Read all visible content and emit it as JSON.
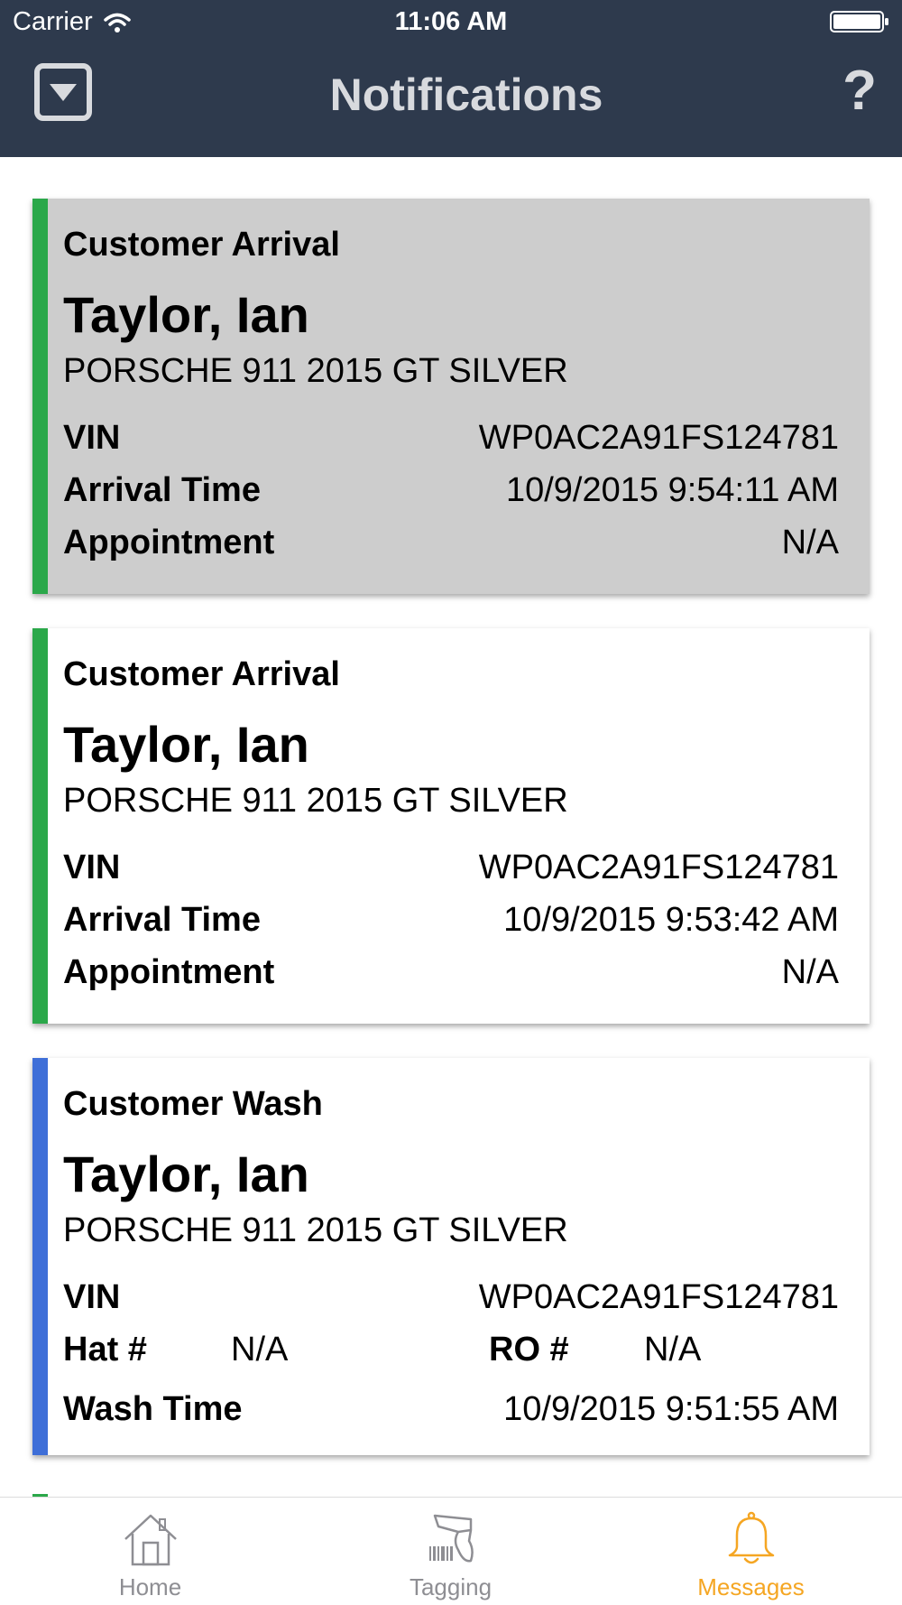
{
  "status_bar": {
    "carrier": "Carrier",
    "time": "11:06 AM"
  },
  "nav": {
    "title": "Notifications",
    "help_label": "?"
  },
  "colors": {
    "navbar": "#2e3a4d",
    "arrival_stripe": "#2ba84a",
    "wash_stripe": "#3f6fd8",
    "read_card": "#cdcdcd",
    "active_tab": "#f5a623"
  },
  "notifications": [
    {
      "type": "Customer Arrival",
      "name": "Taylor, Ian",
      "vehicle": "PORSCHE 911 2015 GT SILVER",
      "vin_label": "VIN",
      "vin": "WP0AC2A91FS124781",
      "time_label": "Arrival Time",
      "time": "10/9/2015 9:54:11 AM",
      "appointment_label": "Appointment",
      "appointment": "N/A"
    },
    {
      "type": "Customer Arrival",
      "name": "Taylor, Ian",
      "vehicle": "PORSCHE 911 2015 GT SILVER",
      "vin_label": "VIN",
      "vin": "WP0AC2A91FS124781",
      "time_label": "Arrival Time",
      "time": "10/9/2015 9:53:42 AM",
      "appointment_label": "Appointment",
      "appointment": "N/A"
    },
    {
      "type": "Customer Wash",
      "name": "Taylor, Ian",
      "vehicle": "PORSCHE 911 2015 GT SILVER",
      "vin_label": "VIN",
      "vin": "WP0AC2A91FS124781",
      "hat_label": "Hat #",
      "hat": "N/A",
      "ro_label": "RO #",
      "ro": "N/A",
      "time_label": "Wash Time",
      "time": "10/9/2015 9:51:55 AM"
    }
  ],
  "tabbar": {
    "items": [
      {
        "label": "Home",
        "icon": "home-icon"
      },
      {
        "label": "Tagging",
        "icon": "barcode-scanner-icon"
      },
      {
        "label": "Messages",
        "icon": "bell-icon",
        "active": true
      }
    ]
  }
}
